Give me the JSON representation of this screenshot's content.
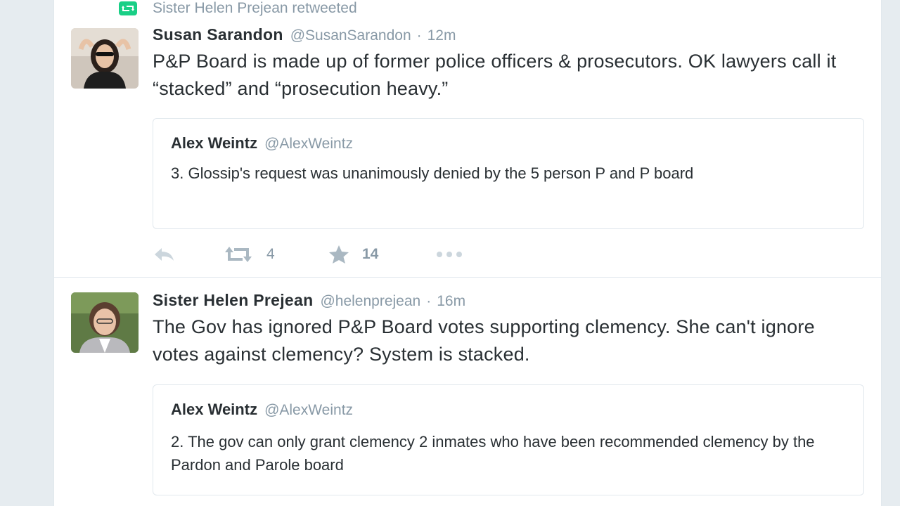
{
  "retweet_context": {
    "text": "Sister Helen Prejean retweeted",
    "icon": "retweet-icon",
    "color": "#19cf86"
  },
  "tweets": [
    {
      "fullname": "Susan Sarandon",
      "username": "@SusanSarandon",
      "separator": "·",
      "time": "12m",
      "text": "P&P Board is made up of former police officers & prosecutors. OK lawyers call it “stacked” and “prosecution heavy.”",
      "quote": {
        "fullname": "Alex Weintz",
        "username": "@AlexWeintz",
        "text": "3. Glossip's request was unanimously denied by the 5 person P and P board"
      },
      "actions": {
        "reply_icon": "reply-icon",
        "retweet_icon": "retweet-icon",
        "retweets": "4",
        "favorite_icon": "star-icon",
        "favorites": "14",
        "more_icon": "more-icon"
      }
    },
    {
      "fullname": "Sister Helen Prejean",
      "username": "@helenprejean",
      "separator": "·",
      "time": "16m",
      "text": "The Gov has ignored P&P Board votes supporting clemency. She can't ignore votes against clemency? System is stacked.",
      "quote": {
        "fullname": "Alex Weintz",
        "username": "@AlexWeintz",
        "text": "2. The gov can only grant clemency 2 inmates who have been recommended clemency by the Pardon and Parole board"
      }
    }
  ]
}
